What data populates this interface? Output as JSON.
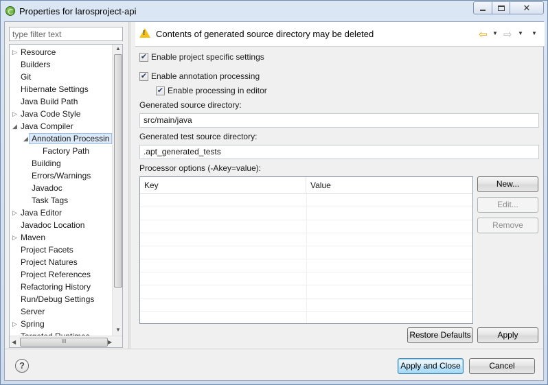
{
  "window": {
    "title": "Properties for larosproject-api",
    "min_glyph": "",
    "close_glyph": "✕"
  },
  "nav": {
    "filter_placeholder": "type filter text",
    "items": [
      {
        "label": "Resource",
        "level": 1,
        "twisty": "▷"
      },
      {
        "label": "Builders",
        "level": 1,
        "twisty": ""
      },
      {
        "label": "Git",
        "level": 1,
        "twisty": ""
      },
      {
        "label": "Hibernate Settings",
        "level": 1,
        "twisty": ""
      },
      {
        "label": "Java Build Path",
        "level": 1,
        "twisty": ""
      },
      {
        "label": "Java Code Style",
        "level": 1,
        "twisty": "▷"
      },
      {
        "label": "Java Compiler",
        "level": 1,
        "twisty": "◢"
      },
      {
        "label": "Annotation Processin",
        "level": 2,
        "twisty": "◢",
        "selected": true
      },
      {
        "label": "Factory Path",
        "level": 3,
        "twisty": ""
      },
      {
        "label": "Building",
        "level": 2,
        "twisty": ""
      },
      {
        "label": "Errors/Warnings",
        "level": 2,
        "twisty": ""
      },
      {
        "label": "Javadoc",
        "level": 2,
        "twisty": ""
      },
      {
        "label": "Task Tags",
        "level": 2,
        "twisty": ""
      },
      {
        "label": "Java Editor",
        "level": 1,
        "twisty": "▷"
      },
      {
        "label": "Javadoc Location",
        "level": 1,
        "twisty": ""
      },
      {
        "label": "Maven",
        "level": 1,
        "twisty": "▷"
      },
      {
        "label": "Project Facets",
        "level": 1,
        "twisty": ""
      },
      {
        "label": "Project Natures",
        "level": 1,
        "twisty": ""
      },
      {
        "label": "Project References",
        "level": 1,
        "twisty": ""
      },
      {
        "label": "Refactoring History",
        "level": 1,
        "twisty": ""
      },
      {
        "label": "Run/Debug Settings",
        "level": 1,
        "twisty": ""
      },
      {
        "label": "Server",
        "level": 1,
        "twisty": ""
      },
      {
        "label": "Spring",
        "level": 1,
        "twisty": "▷"
      },
      {
        "label": "Targeted Runtimes",
        "level": 1,
        "twisty": ""
      }
    ],
    "scroll_up": "▲",
    "scroll_down": "▼",
    "scroll_left": "◀",
    "scroll_right": "▶",
    "hthumb_grip": "III"
  },
  "header": {
    "message": "Contents of generated source directory may be deleted",
    "warn_mark": "!",
    "back_glyph": "⇦",
    "fwd_glyph": "⇨",
    "dropdown_glyph": "▼"
  },
  "settings": {
    "enable_project_specific": {
      "label": "Enable project specific settings",
      "checked": true
    },
    "enable_annotation_processing": {
      "label": "Enable annotation processing",
      "checked": true
    },
    "enable_processing_in_editor": {
      "label": "Enable processing in editor",
      "checked": true
    },
    "check_glyph": "✔",
    "gen_source_dir_label": "Generated source directory:",
    "gen_source_dir_value": "src/main/java",
    "gen_test_dir_label": "Generated test source directory:",
    "gen_test_dir_value": ".apt_generated_tests",
    "processor_options_label": "Processor options (-Akey=value):"
  },
  "table": {
    "columns": [
      "Key",
      "Value"
    ],
    "rows": []
  },
  "buttons": {
    "new": "New...",
    "edit": "Edit...",
    "remove": "Remove",
    "restore_defaults": "Restore Defaults",
    "apply": "Apply",
    "apply_and_close": "Apply and Close",
    "cancel": "Cancel",
    "help": "?"
  }
}
